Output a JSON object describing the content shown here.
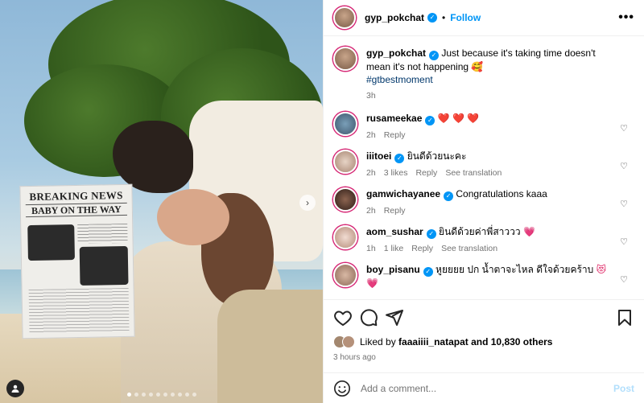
{
  "header": {
    "username": "gyp_pokchat",
    "separator": "•",
    "follow_label": "Follow",
    "more_label": "•••"
  },
  "media": {
    "newspaper_title": "BREAKING NEWS",
    "newspaper_subtitle": "BABY ON THE WAY",
    "next_arrow": "›",
    "carousel_count": 10,
    "carousel_active": 0
  },
  "caption": {
    "username": "gyp_pokchat",
    "text": "Just because it's taking time doesn't mean it's not happening",
    "emoji": "🥰",
    "hashtag": "#gtbestmoment",
    "time": "3h"
  },
  "comments": [
    {
      "username": "rusameekae",
      "text": "",
      "emoji": "❤️ ❤️ ❤️",
      "time": "2h",
      "likes": "",
      "reply": "Reply",
      "translation": ""
    },
    {
      "username": "iiitoei",
      "text": "ยินดีด้วยนะคะ",
      "emoji": "",
      "time": "2h",
      "likes": "3 likes",
      "reply": "Reply",
      "translation": "See translation"
    },
    {
      "username": "gamwichayanee",
      "text": "Congratulations kaaa",
      "emoji": "",
      "time": "2h",
      "likes": "",
      "reply": "Reply",
      "translation": ""
    },
    {
      "username": "aom_sushar",
      "text": "ยินดีด้วยค่าพี่สาววว",
      "emoji": "💗",
      "time": "1h",
      "likes": "1 like",
      "reply": "Reply",
      "translation": "See translation"
    },
    {
      "username": "boy_pisanu",
      "text": "หูยยยย ปก น้ำตาจะไหล ดีใจด้วยคร้าบ",
      "emoji": "😻 💗",
      "time": "",
      "likes": "",
      "reply": "",
      "translation": ""
    }
  ],
  "likes": {
    "prefix": "Liked by",
    "user": "faaaiiii_natapat",
    "suffix": "and 10,830 others"
  },
  "posted_ago": "3 hours ago",
  "add_comment": {
    "placeholder": "Add a comment...",
    "post_label": "Post"
  },
  "colors": {
    "accent": "#0095f6",
    "secondary_text": "#737373",
    "divider": "#efefef",
    "story_ring": "#d62976",
    "hashtag": "#00376b"
  }
}
